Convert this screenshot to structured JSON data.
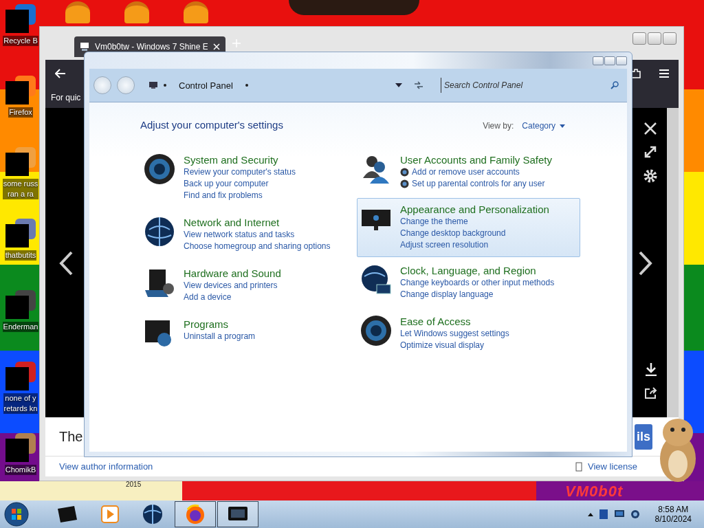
{
  "desktop": {
    "icons": [
      {
        "kind": "bin",
        "lines": [
          "Recycle B"
        ]
      },
      {
        "kind": "fox",
        "lines": [
          "Firefox"
        ]
      },
      {
        "kind": "doc",
        "lines": [
          "some russ",
          "ran a ra"
        ]
      },
      {
        "kind": "stack",
        "lines": [
          "thatbutits"
        ]
      },
      {
        "kind": "window",
        "lines": [
          "Enderman"
        ]
      },
      {
        "kind": "disc",
        "lines": [
          "none of y",
          "retards kn"
        ]
      },
      {
        "kind": "hamster",
        "lines": [
          "ChomikB"
        ]
      }
    ],
    "year_text": "2015",
    "logo_text": "VM0b0t"
  },
  "browser": {
    "tab_title": "Vm0b0tw - Windows 7 Shine E",
    "toolbar_text": "For quic",
    "caption": "The",
    "details_button": "ils",
    "author_link": "View author information",
    "license_link": "View license"
  },
  "control_panel": {
    "breadcrumb": "Control Panel",
    "search": {
      "placeholder": "Search Control Panel"
    },
    "heading": "Adjust your computer's settings",
    "view_by_label": "View by:",
    "view_by_value": "Category",
    "columns": [
      [
        {
          "kind": "orb",
          "title": "System and Security",
          "highlighted": false,
          "links": [
            {
              "text": "Review your computer's status",
              "shield": false
            },
            {
              "text": "Back up your computer",
              "shield": false
            },
            {
              "text": "Find and fix problems",
              "shield": false
            }
          ]
        },
        {
          "kind": "globe",
          "title": "Network and Internet",
          "highlighted": false,
          "links": [
            {
              "text": "View network status and tasks",
              "shield": false
            },
            {
              "text": "Choose homegroup and sharing options",
              "shield": false
            }
          ]
        },
        {
          "kind": "printer",
          "title": "Hardware and Sound",
          "highlighted": false,
          "links": [
            {
              "text": "View devices and printers",
              "shield": false
            },
            {
              "text": "Add a device",
              "shield": false
            }
          ]
        },
        {
          "kind": "screen",
          "title": "Programs",
          "highlighted": false,
          "links": [
            {
              "text": "Uninstall a program",
              "shield": false
            }
          ]
        }
      ],
      [
        {
          "kind": "people",
          "title": "User Accounts and Family Safety",
          "highlighted": false,
          "links": [
            {
              "text": "Add or remove user accounts",
              "shield": true
            },
            {
              "text": "Set up parental controls for any user",
              "shield": true
            }
          ]
        },
        {
          "kind": "monitor",
          "title": "Appearance and Personalization",
          "highlighted": true,
          "links": [
            {
              "text": "Change the theme",
              "shield": false
            },
            {
              "text": "Change desktop background",
              "shield": false
            },
            {
              "text": "Adjust screen resolution",
              "shield": false
            }
          ]
        },
        {
          "kind": "clock",
          "title": "Clock, Language, and Region",
          "highlighted": false,
          "links": [
            {
              "text": "Change keyboards or other input methods",
              "shield": false
            },
            {
              "text": "Change display language",
              "shield": false
            }
          ]
        },
        {
          "kind": "orb",
          "title": "Ease of Access",
          "highlighted": false,
          "links": [
            {
              "text": "Let Windows suggest settings",
              "shield": false
            },
            {
              "text": "Optimize visual display",
              "shield": false
            }
          ]
        }
      ]
    ]
  },
  "taskbar": {
    "apps": [
      {
        "kind": "box",
        "open": false
      },
      {
        "kind": "player",
        "open": false
      },
      {
        "kind": "globe",
        "open": false
      },
      {
        "kind": "fox",
        "open": true
      },
      {
        "kind": "screen",
        "open": true
      }
    ],
    "time": "8:58 AM",
    "date": "8/10/2024"
  }
}
